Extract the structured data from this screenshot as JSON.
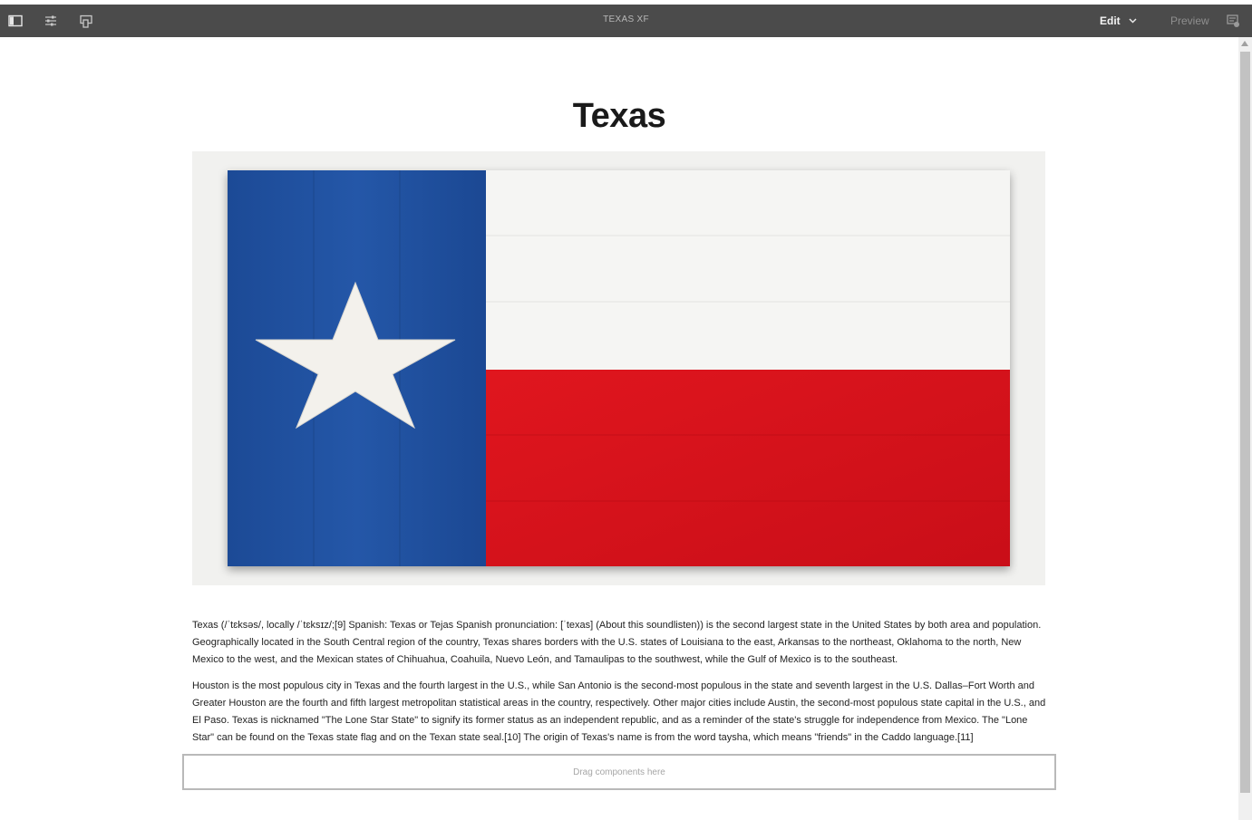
{
  "toolbar": {
    "title": "TEXAS XF",
    "edit_label": "Edit",
    "preview_label": "Preview"
  },
  "page": {
    "title": "Texas",
    "paragraphs": [
      "Texas (/ˈtɛksəs/, locally /ˈtɛksɪz/;[9] Spanish: Texas or Tejas Spanish pronunciation: [ˈtexas] (About this soundlisten)) is the second largest state in the United States by both area and population. Geographically located in the South Central region of the country, Texas shares borders with the U.S. states of Louisiana to the east, Arkansas to the northeast, Oklahoma to the north, New Mexico to the west, and the Mexican states of Chihuahua, Coahuila, Nuevo León, and Tamaulipas to the southwest, while the Gulf of Mexico is to the southeast.",
      "Houston is the most populous city in Texas and the fourth largest in the U.S., while San Antonio is the second-most populous in the state and seventh largest in the U.S. Dallas–Fort Worth and Greater Houston are the fourth and fifth largest metropolitan statistical areas in the country, respectively. Other major cities include Austin, the second-most populous state capital in the U.S., and El Paso. Texas is nicknamed \"The Lone Star State\" to signify its former status as an independent republic, and as a reminder of the state's struggle for independence from Mexico. The \"Lone Star\" can be found on the Texas state flag and on the Texan state seal.[10] The origin of Texas's name is from the word taysha, which means \"friends\" in the Caddo language.[11]"
    ],
    "dropzone_label": "Drag components here"
  },
  "icons": {
    "toggle_side_panel": "side-panel-icon",
    "page_properties": "sliders-icon",
    "emulator": "device-emulator-icon",
    "edit_dropdown": "chevron-down-icon",
    "annotations": "annotations-icon"
  },
  "colors": {
    "toolbar_bg": "#4b4b4b",
    "flag_blue": "#1e4f9e",
    "flag_red": "#d9121b",
    "flag_white": "#f4f4f2"
  }
}
